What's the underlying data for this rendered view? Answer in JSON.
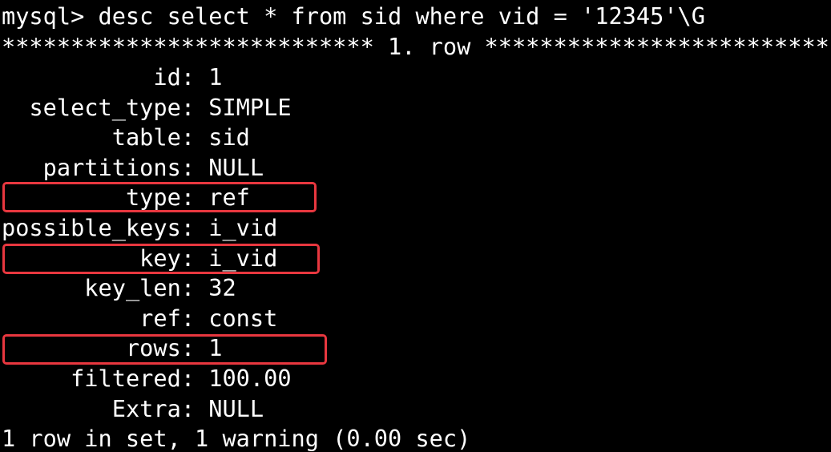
{
  "terminal": {
    "command": "mysql> desc select * from sid where vid = '12345'\\G",
    "row_header": "*************************** 1. row ***************************",
    "rows": [
      {
        "key": "id",
        "value": "1"
      },
      {
        "key": "select_type",
        "value": "SIMPLE"
      },
      {
        "key": "table",
        "value": "sid"
      },
      {
        "key": "partitions",
        "value": "NULL"
      },
      {
        "key": "type",
        "value": "ref"
      },
      {
        "key": "possible_keys",
        "value": "i_vid"
      },
      {
        "key": "key",
        "value": "i_vid"
      },
      {
        "key": "key_len",
        "value": "32"
      },
      {
        "key": "ref",
        "value": "const"
      },
      {
        "key": "rows",
        "value": "1"
      },
      {
        "key": "filtered",
        "value": "100.00"
      },
      {
        "key": "Extra",
        "value": "NULL"
      }
    ],
    "footer": "1 row in set, 1 warning (0.00 sec)"
  },
  "highlighted_rows": [
    "type",
    "key",
    "rows"
  ],
  "colors": {
    "background": "#000000",
    "text": "#ffffff",
    "highlight_border": "#e8373f"
  }
}
